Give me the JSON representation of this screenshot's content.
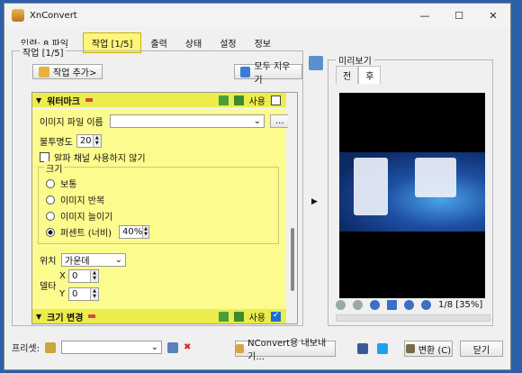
{
  "window": {
    "title": "XnConvert"
  },
  "tabs": {
    "input": "입력: 8 파일",
    "items": [
      "작업 [1/5]",
      "출력",
      "상태",
      "설정",
      "정보"
    ],
    "active_index": 0
  },
  "actions": {
    "group_title": "작업 [1/5]",
    "add_label": "작업 추가>",
    "clear_label": "모두 지우기",
    "filters": [
      {
        "name": "워터마크",
        "use_label": "사용",
        "enabled": false,
        "expanded": true
      },
      {
        "name": "크기 변경",
        "use_label": "사용",
        "enabled": true,
        "expanded": false
      }
    ]
  },
  "watermark": {
    "image_label": "이미지 파일 이름",
    "image_value": "",
    "browse_label": "...",
    "opacity_label": "불투명도",
    "opacity_value": "20",
    "alpha_label": "알파 채널 사용하지 않기",
    "alpha_checked": false,
    "size_group": "크기",
    "size_options": [
      "보통",
      "이미지 반복",
      "이미지 늘이기",
      "퍼센트 (너비)"
    ],
    "size_selected": 3,
    "percent_value": "40%",
    "position_label": "위치",
    "position_value": "가운데",
    "delta_label": "델타",
    "delta_x_label": "X",
    "delta_x": "0",
    "delta_y_label": "Y",
    "delta_y": "0"
  },
  "preview": {
    "title": "미리보기",
    "tabs": [
      "전",
      "후"
    ],
    "active_tab": 1,
    "page_info": "1/8 [35%]"
  },
  "footer": {
    "preset_label": "프리셋:",
    "preset_value": "",
    "export_label": "NConvert용 내보내기...",
    "convert_label": "변환 (C)",
    "close_label": "닫기"
  }
}
